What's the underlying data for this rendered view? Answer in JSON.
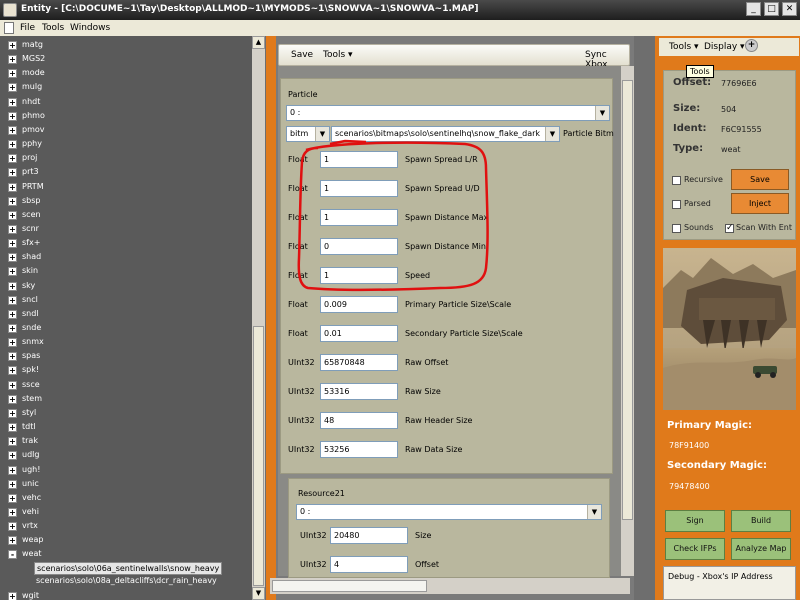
{
  "window": {
    "title": "Entity - [C:\\DOCUME~1\\Tay\\Desktop\\ALLMOD~1\\MYMODS~1\\SNOWVA~1\\SNOWVA~1.MAP]",
    "minimize": "_",
    "maximize": "□",
    "close": "✕"
  },
  "menu": {
    "file": "File",
    "tools": "Tools",
    "windows": "Windows"
  },
  "tree": {
    "items": [
      "matg",
      "MGS2",
      "mode",
      "mulg",
      "nhdt",
      "phmo",
      "pmov",
      "pphy",
      "proj",
      "prt3",
      "PRTM",
      "sbsp",
      "scen",
      "scnr",
      "sfx+",
      "shad",
      "skin",
      "sky",
      "sncl",
      "sndl",
      "snde",
      "snmx",
      "spas",
      "spk!",
      "ssce",
      "stem",
      "styl",
      "tdtl",
      "trak",
      "udlg",
      "ugh!",
      "unic",
      "vehc",
      "vehi",
      "vrtx",
      "weap",
      "weat"
    ],
    "expanded_item": "weat",
    "children": [
      "scenarios\\solo\\06a_sentinelwalls\\snow_heavy",
      "scenarios\\solo\\08a_deltacliffs\\dcr_rain_heavy"
    ],
    "selected_child": 0,
    "last_item": "wgit",
    "plus": "+",
    "minus": "-"
  },
  "toolbar": {
    "save": "Save",
    "tools": "Tools ▾",
    "sync": "Sync Xbox"
  },
  "particle": {
    "group_label": "Particle",
    "index_value": "0 :",
    "tag_type": "bitm",
    "tag_path": "scenarios\\bitmaps\\solo\\sentinelhq\\snow_flake_dark",
    "tag_label": "Particle Bitm",
    "fields": [
      {
        "type": "Float",
        "value": "1",
        "name": "Spawn Spread L/R"
      },
      {
        "type": "Float",
        "value": "1",
        "name": "Spawn Spread U/D"
      },
      {
        "type": "Float",
        "value": "1",
        "name": "Spawn Distance Max"
      },
      {
        "type": "Float",
        "value": "0",
        "name": "Spawn Distance Min"
      },
      {
        "type": "Float",
        "value": "1",
        "name": "Speed"
      },
      {
        "type": "Float",
        "value": "0.009",
        "name": "Primary Particle Size\\Scale"
      },
      {
        "type": "Float",
        "value": "0.01",
        "name": "Secondary Particle Size\\Scale"
      },
      {
        "type": "UInt32",
        "value": "65870848",
        "name": "Raw Offset"
      },
      {
        "type": "UInt32",
        "value": "53316",
        "name": "Raw Size"
      },
      {
        "type": "UInt32",
        "value": "48",
        "name": "Raw Header Size"
      },
      {
        "type": "UInt32",
        "value": "53256",
        "name": "Raw Data Size"
      }
    ]
  },
  "resource": {
    "group_label": "Resource21",
    "index_value": "0 :",
    "fields": [
      {
        "type": "UInt32",
        "value": "20480",
        "name": "Size"
      },
      {
        "type": "UInt32",
        "value": "4",
        "name": "Offset"
      }
    ]
  },
  "right_panel": {
    "toolbar": {
      "tools": "Tools ▾",
      "display": "Display ▾"
    },
    "tooltip": "Tools",
    "offset_label": "Offset:",
    "offset_value": "77696E6",
    "size_label": "Size:",
    "size_value": "504",
    "ident_label": "Ident:",
    "ident_value": "F6C91555",
    "type_label": "Type:",
    "type_value": "weat",
    "recursive": "Recursive",
    "parsed": "Parsed",
    "sounds": "Sounds",
    "scan_with_ent": "Scan With Ent",
    "save_btn": "Save",
    "inject_btn": "Inject",
    "primary_magic_label": "Primary Magic:",
    "primary_magic_value": "78F91400",
    "secondary_magic_label": "Secondary Magic:",
    "secondary_magic_value": "79478400",
    "sign_btn": "Sign",
    "build_btn": "Build",
    "check_ifps_btn": "Check IFPs",
    "analyze_btn": "Analyze Map",
    "debug_text": "Debug - Xbox's IP Address"
  }
}
